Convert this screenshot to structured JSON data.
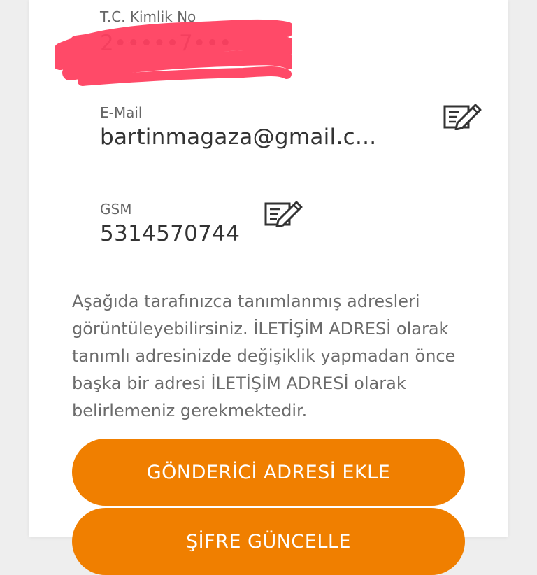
{
  "profile": {
    "tc_label": "T.C. Kimlik No",
    "tc_value": "2•••••7•••",
    "email_label": "E-Mail",
    "email_value": "bartinmagaza@gmail.c...",
    "gsm_label": "GSM",
    "gsm_value": "5314570744"
  },
  "info_text": "Aşağıda tarafınızca tanımlanmış adresleri görüntüleyebilirsiniz. İLETİŞİM ADRESİ olarak tanımlı adresinizde değişiklik yapmadan önce başka bir adresi İLETİŞİM ADRESİ olarak belirlemeniz gerekmektedir.",
  "buttons": {
    "add_sender_address": "GÖNDERİCİ ADRESİ EKLE",
    "update_password": "ŞİFRE GÜNCELLE"
  },
  "colors": {
    "accent": "#f07f00",
    "redaction": "#ff3b5c"
  },
  "icons": {
    "email_edit": "edit-icon",
    "gsm_edit": "edit-icon"
  }
}
